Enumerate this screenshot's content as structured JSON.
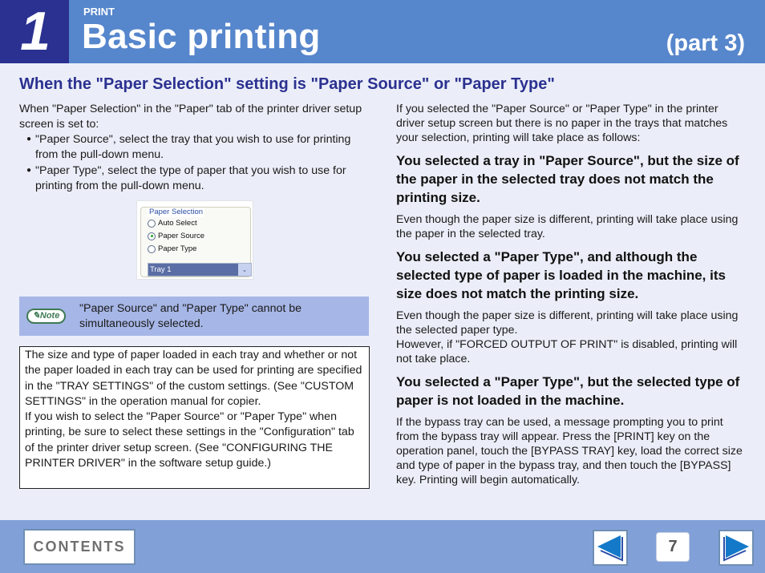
{
  "header": {
    "chapter_number": "1",
    "section_label": "PRINT",
    "title": "Basic printing",
    "part": "(part 3)"
  },
  "subheading": "When the \"Paper Selection\" setting is \"Paper Source\" or \"Paper Type\"",
  "left": {
    "intro": "When \"Paper Selection\" in the \"Paper\" tab of the printer driver setup screen is set to:",
    "bullets": [
      "\"Paper Source\", select the tray that you wish to use for printing from the pull-down menu.",
      "\"Paper Type\", select the type of paper that you wish to use for printing from the pull-down menu."
    ],
    "bullet_glyph": "●",
    "dialog": {
      "group_label": "Paper Selection",
      "options": [
        {
          "label": "Auto Select",
          "checked": false
        },
        {
          "label": "Paper Source",
          "checked": true
        },
        {
          "label": "Paper Type",
          "checked": false
        }
      ],
      "select_value": "Tray 1",
      "select_arrow": "⌄"
    },
    "note": {
      "badge": "✎Note",
      "text": "\"Paper Source\" and \"Paper Type\" cannot be simultaneously selected."
    },
    "info_box": [
      "The size and type of paper loaded in each tray and whether or not the paper loaded in each tray can be used for printing are specified in the \"TRAY SETTINGS\" of the custom settings. (See \"CUSTOM SETTINGS\" in the operation manual for copier.",
      "If you wish to select the \"Paper Source\" or \"Paper Type\" when printing, be sure to select these settings in the \"Configuration\" tab of the printer driver setup screen. (See \"CONFIGURING THE PRINTER DRIVER\" in the software setup guide.)"
    ]
  },
  "right": {
    "intro": "If you selected the \"Paper Source\" or \"Paper Type\" in the printer driver setup screen but there is no paper in the trays that matches your selection, printing will take place as follows:",
    "cases": [
      {
        "heading": "You selected a tray in \"Paper Source\", but the size of the paper in the selected tray does not match the printing size.",
        "body": "Even though the paper size is different, printing will take place using the paper in the selected tray."
      },
      {
        "heading": "You selected a \"Paper Type\", and although the selected type of paper is loaded in the machine, its size does not match the printing size.",
        "body": "Even though the paper size is different, printing will take place using the selected paper type.",
        "body2": "However, if \"FORCED OUTPUT OF PRINT\" is disabled, printing will not take place."
      },
      {
        "heading": "You selected a \"Paper Type\", but the selected type of paper is not loaded in the machine.",
        "body": "If the bypass tray can be used, a message prompting you to print from the bypass tray will appear. Press the [PRINT] key on the operation panel, touch the [BYPASS TRAY] key, load the correct size and type of paper in the bypass tray, and then touch the [BYPASS] key. Printing will begin automatically."
      }
    ]
  },
  "footer": {
    "contents_label": "CONTENTS",
    "page_number": "7",
    "prev_icon": "left-arrow-icon",
    "next_icon": "right-arrow-icon"
  },
  "colors": {
    "header_bg": "#5686cc",
    "chapter_bg": "#2b3190",
    "heading_text": "#2b3190",
    "page_bg": "#ebeef8",
    "note_bg": "#a6b6e6",
    "footer_bg": "#82a0d8",
    "arrow_blue": "#1579c9"
  }
}
